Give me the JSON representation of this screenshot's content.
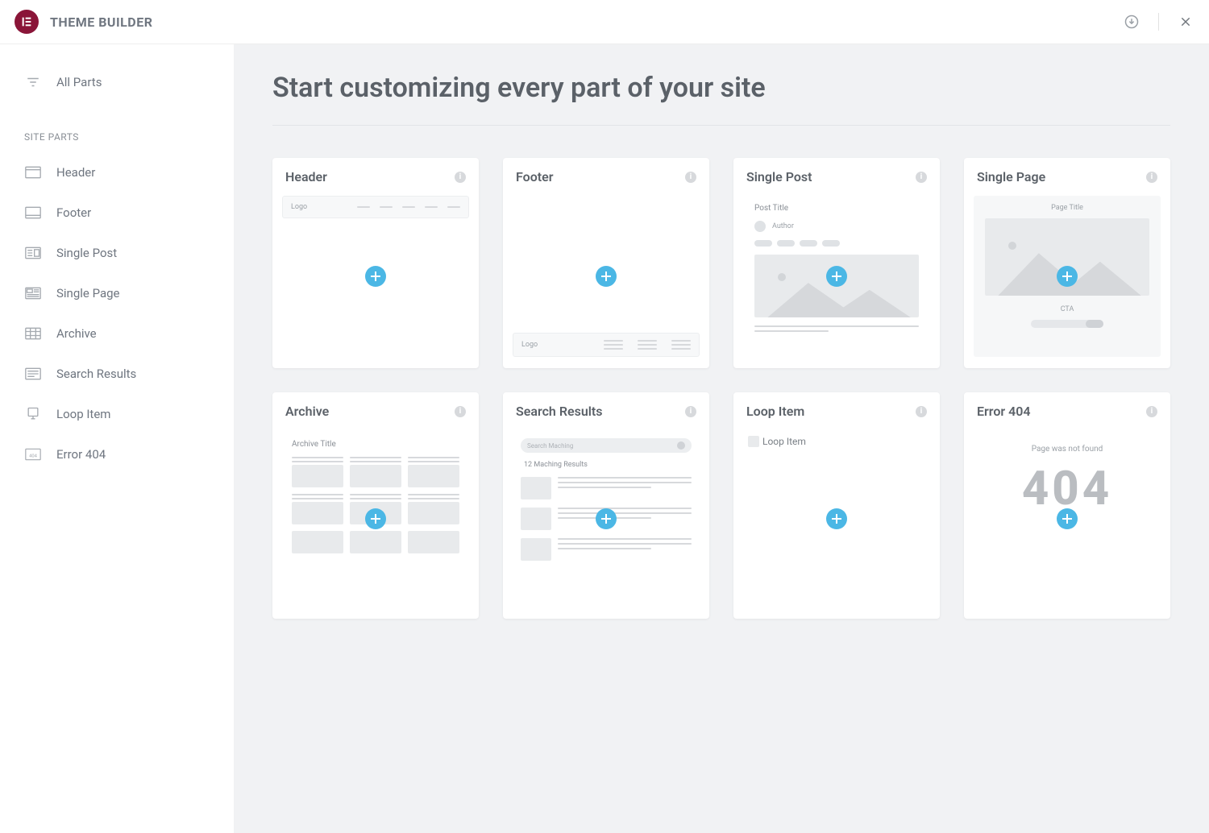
{
  "header": {
    "title": "THEME BUILDER"
  },
  "sidebar": {
    "all_parts": "All Parts",
    "section_label": "SITE PARTS",
    "items": [
      {
        "label": "Header"
      },
      {
        "label": "Footer"
      },
      {
        "label": "Single Post"
      },
      {
        "label": "Single Page"
      },
      {
        "label": "Archive"
      },
      {
        "label": "Search Results"
      },
      {
        "label": "Loop Item"
      },
      {
        "label": "Error 404"
      }
    ]
  },
  "main": {
    "heading": "Start customizing every part of your site",
    "cards": [
      {
        "title": "Header",
        "preview": {
          "logo_label": "Logo"
        }
      },
      {
        "title": "Footer",
        "preview": {
          "logo_label": "Logo"
        }
      },
      {
        "title": "Single Post",
        "preview": {
          "post_title": "Post Title",
          "author_label": "Author"
        }
      },
      {
        "title": "Single Page",
        "preview": {
          "page_title": "Page Title",
          "cta_label": "CTA"
        }
      },
      {
        "title": "Archive",
        "preview": {
          "archive_title": "Archive Title"
        }
      },
      {
        "title": "Search Results",
        "preview": {
          "search_placeholder": "Search Maching",
          "results_label": "12 Maching Results"
        }
      },
      {
        "title": "Loop Item",
        "preview": {
          "alt_text": "Loop Item"
        }
      },
      {
        "title": "Error 404",
        "preview": {
          "message": "Page was not found",
          "code": "404"
        }
      }
    ]
  }
}
